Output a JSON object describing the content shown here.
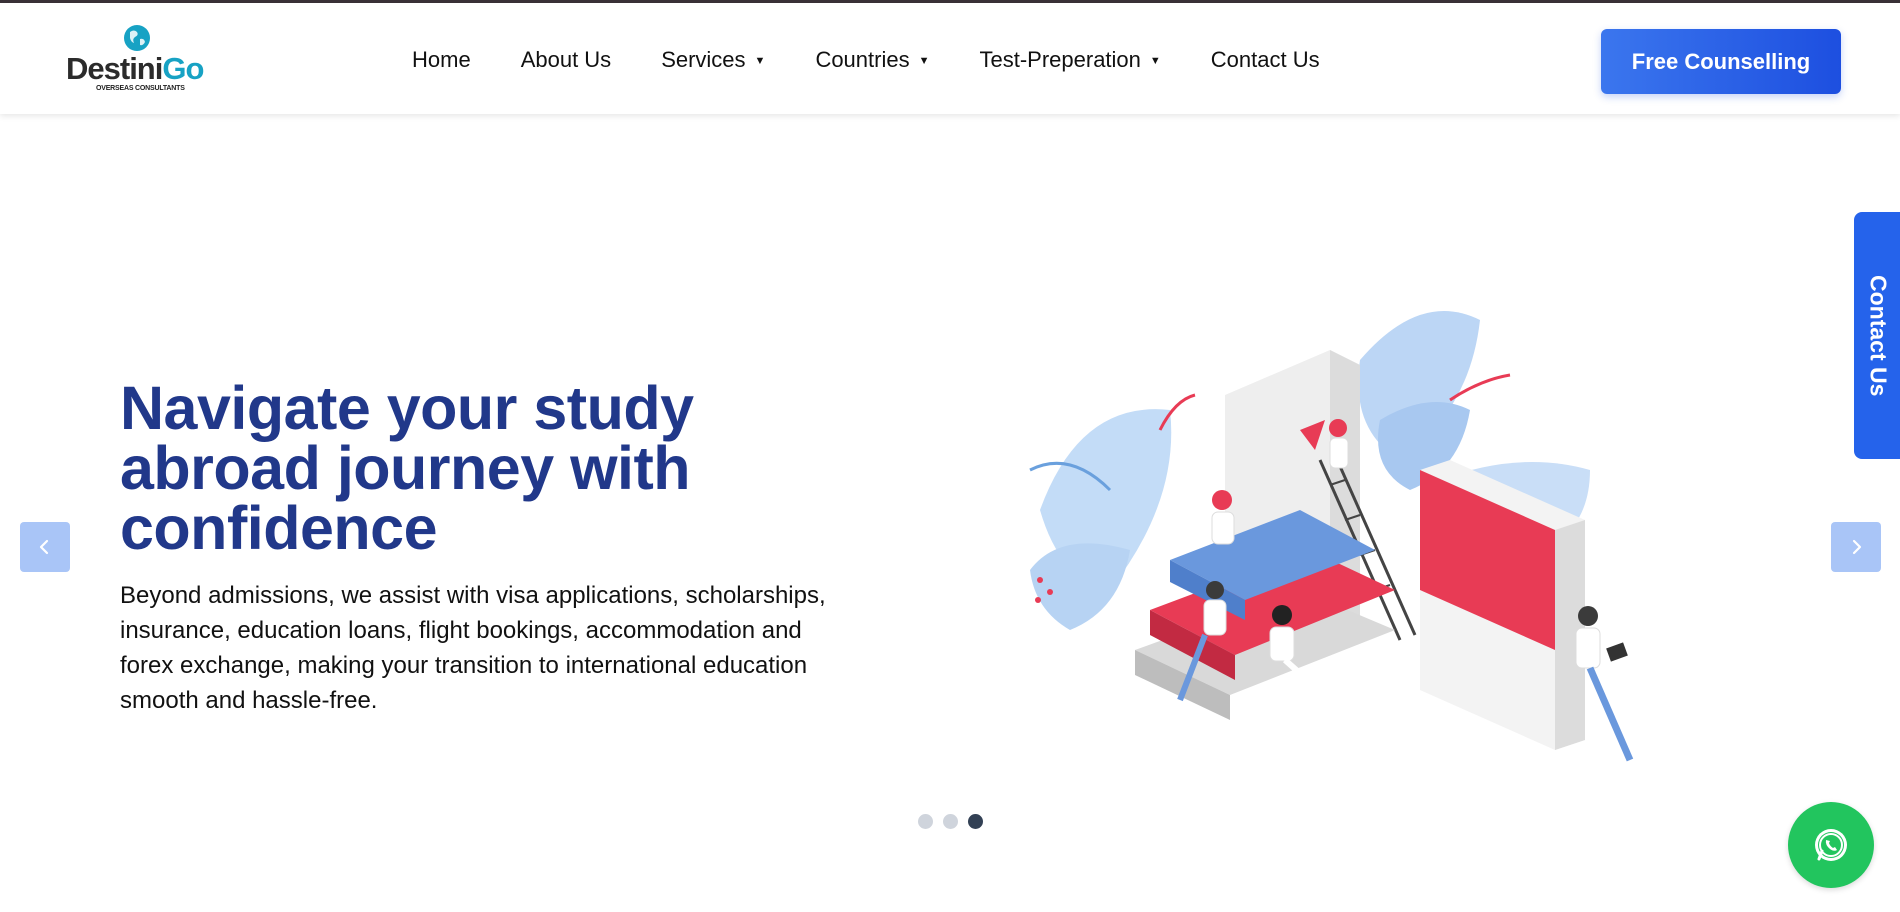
{
  "header": {
    "logo": {
      "brand_part1": "Destini",
      "brand_part2": "Go",
      "tagline": "OVERSEAS CONSULTANTS"
    },
    "nav": [
      {
        "label": "Home",
        "has_dropdown": false
      },
      {
        "label": "About Us",
        "has_dropdown": false
      },
      {
        "label": "Services",
        "has_dropdown": true
      },
      {
        "label": "Countries",
        "has_dropdown": true
      },
      {
        "label": "Test-Preperation",
        "has_dropdown": true
      },
      {
        "label": "Contact Us",
        "has_dropdown": false
      }
    ],
    "cta_label": "Free Counselling"
  },
  "hero": {
    "title": "Navigate your study abroad journey with confidence",
    "description": "Beyond admissions, we assist with visa applications, scholarships, insurance, education loans, flight bookings, accommodation and forex exchange, making your transition to international education smooth and hassle-free."
  },
  "carousel": {
    "slide_count": 3,
    "active_index": 2
  },
  "side_tab_label": "Contact Us",
  "icons": {
    "prev": "chevron-left-icon",
    "next": "chevron-right-icon",
    "dropdown": "caret-down-icon",
    "whatsapp": "whatsapp-icon",
    "globe": "globe-icon"
  },
  "colors": {
    "primary": "#2563eb",
    "title": "#21388a",
    "brand_accent": "#17a2c4",
    "whatsapp": "#22c55e",
    "arrow_bg": "#a9c5f7"
  }
}
